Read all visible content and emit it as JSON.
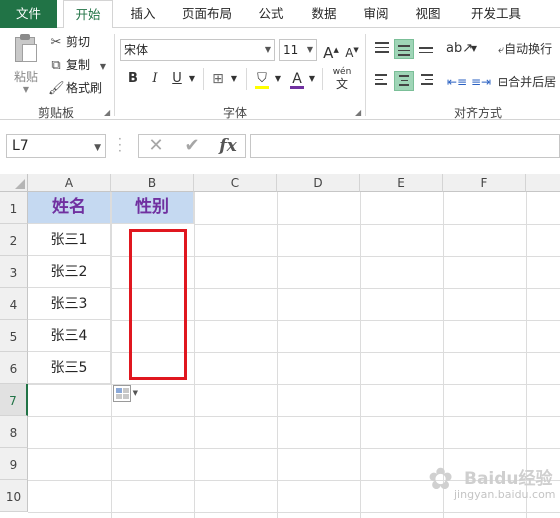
{
  "ribbon": {
    "tabs": [
      "文件",
      "开始",
      "插入",
      "页面布局",
      "公式",
      "数据",
      "审阅",
      "视图",
      "开发工具"
    ],
    "clipboard": {
      "paste": "粘贴",
      "cut": "剪切",
      "copy": "复制",
      "format_painter": "格式刷",
      "group_label": "剪贴板"
    },
    "font": {
      "name": "宋体",
      "size": "11",
      "grow": "A",
      "shrink": "A",
      "bold": "B",
      "italic": "I",
      "underline": "U",
      "font_color_glyph": "A",
      "phonetic": "wén",
      "group_label": "字体"
    },
    "alignment": {
      "wrap_text": "自动换行",
      "merge_center": "合并后居",
      "group_label": "对齐方式"
    }
  },
  "formula_bar": {
    "name_box": "L7",
    "fx": "fx",
    "value": ""
  },
  "sheet": {
    "columns": [
      "A",
      "B",
      "C",
      "D",
      "E",
      "F"
    ],
    "rows": [
      "1",
      "2",
      "3",
      "4",
      "5",
      "6",
      "7",
      "8",
      "9",
      "10"
    ],
    "header": {
      "a1": "姓名",
      "b1": "性别"
    },
    "names": [
      "张三1",
      "张三2",
      "张三3",
      "张三4",
      "张三5"
    ]
  },
  "colors": {
    "accent": "#217346",
    "header_fill": "#c5d9f1",
    "header_text": "#7030a0",
    "highlight_box": "#e0171f"
  },
  "watermark": {
    "brand": "Baidu经验",
    "url": "jingyan.baidu.com"
  }
}
